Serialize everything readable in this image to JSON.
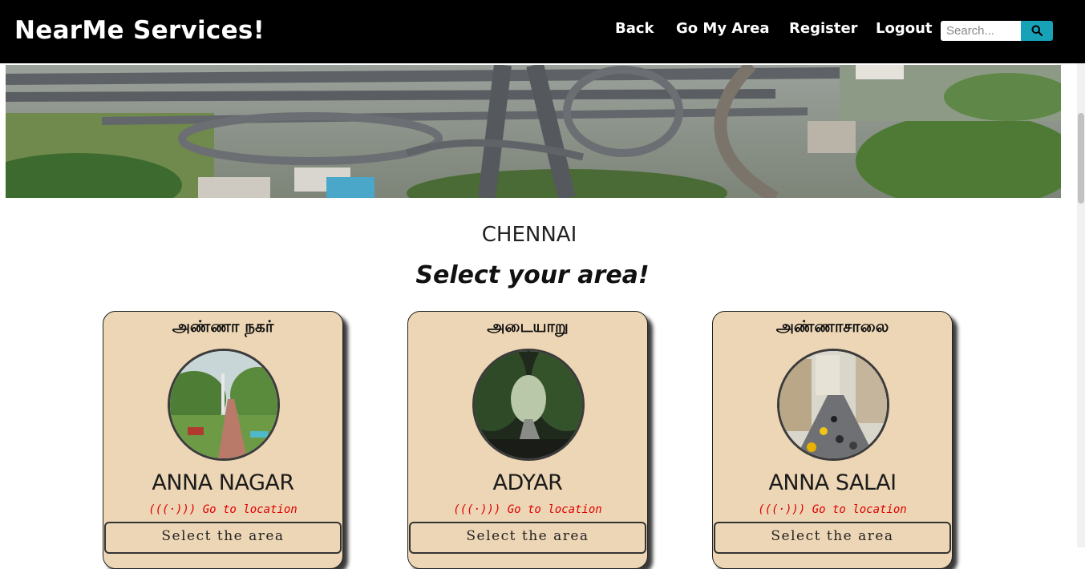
{
  "brand": "NearMe Services!",
  "nav": {
    "back": "Back",
    "go_my_area": "Go My Area",
    "register": "Register",
    "logout": "Logout"
  },
  "search": {
    "placeholder": "Search...",
    "icon": "search-icon"
  },
  "colors": {
    "navbar": "#000000",
    "search_button": "#17a2b8",
    "card_bg": "#edd6b5",
    "location_link": "#e00000"
  },
  "page": {
    "city": "CHENNAI",
    "subtitle": "Select your area!"
  },
  "cards": [
    {
      "tamil": "அண்ணா நகர்",
      "name": "ANNA NAGAR",
      "location_label": "(((·))) Go to location",
      "button": "Select the area"
    },
    {
      "tamil": "அடையாறு",
      "name": "ADYAR",
      "location_label": "(((·))) Go to location",
      "button": "Select the area"
    },
    {
      "tamil": "அண்ணாசாலை",
      "name": "ANNA SALAI",
      "location_label": "(((·))) Go to location",
      "button": "Select the area"
    }
  ]
}
